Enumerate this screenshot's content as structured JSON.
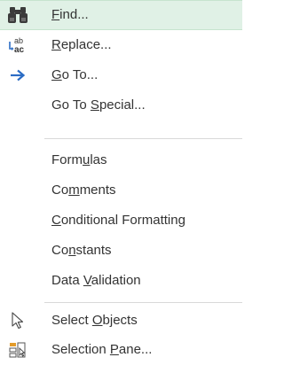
{
  "menu": {
    "items": [
      {
        "pre": "",
        "key": "F",
        "post": "ind...",
        "icon": "binoculars-icon",
        "highlighted": true
      },
      {
        "pre": "",
        "key": "R",
        "post": "eplace...",
        "icon": "replace-icon",
        "highlighted": false
      },
      {
        "pre": "",
        "key": "G",
        "post": "o To...",
        "icon": "arrow-right-icon",
        "highlighted": false
      },
      {
        "pre": "Go To ",
        "key": "S",
        "post": "pecial...",
        "icon": "",
        "highlighted": false
      },
      {
        "pre": "Form",
        "key": "u",
        "post": "las",
        "icon": "",
        "highlighted": false
      },
      {
        "pre": "Co",
        "key": "m",
        "post": "ments",
        "icon": "",
        "highlighted": false
      },
      {
        "pre": "",
        "key": "C",
        "post": "onditional Formatting",
        "icon": "",
        "highlighted": false
      },
      {
        "pre": "Co",
        "key": "n",
        "post": "stants",
        "icon": "",
        "highlighted": false
      },
      {
        "pre": "Data ",
        "key": "V",
        "post": "alidation",
        "icon": "",
        "highlighted": false
      },
      {
        "pre": "Select ",
        "key": "O",
        "post": "bjects",
        "icon": "cursor-arrow-icon",
        "highlighted": false
      },
      {
        "pre": "Selection ",
        "key": "P",
        "post": "ane...",
        "icon": "selection-pane-icon",
        "highlighted": false
      }
    ],
    "replace_icon_text": {
      "top": "ab",
      "bottom": "ac"
    }
  },
  "colors": {
    "highlight_bg": "#e0f1e6",
    "highlight_border": "#c6e4cf",
    "arrow_blue": "#2b6cc4",
    "separator": "#d9d9d9",
    "text": "#333333"
  }
}
